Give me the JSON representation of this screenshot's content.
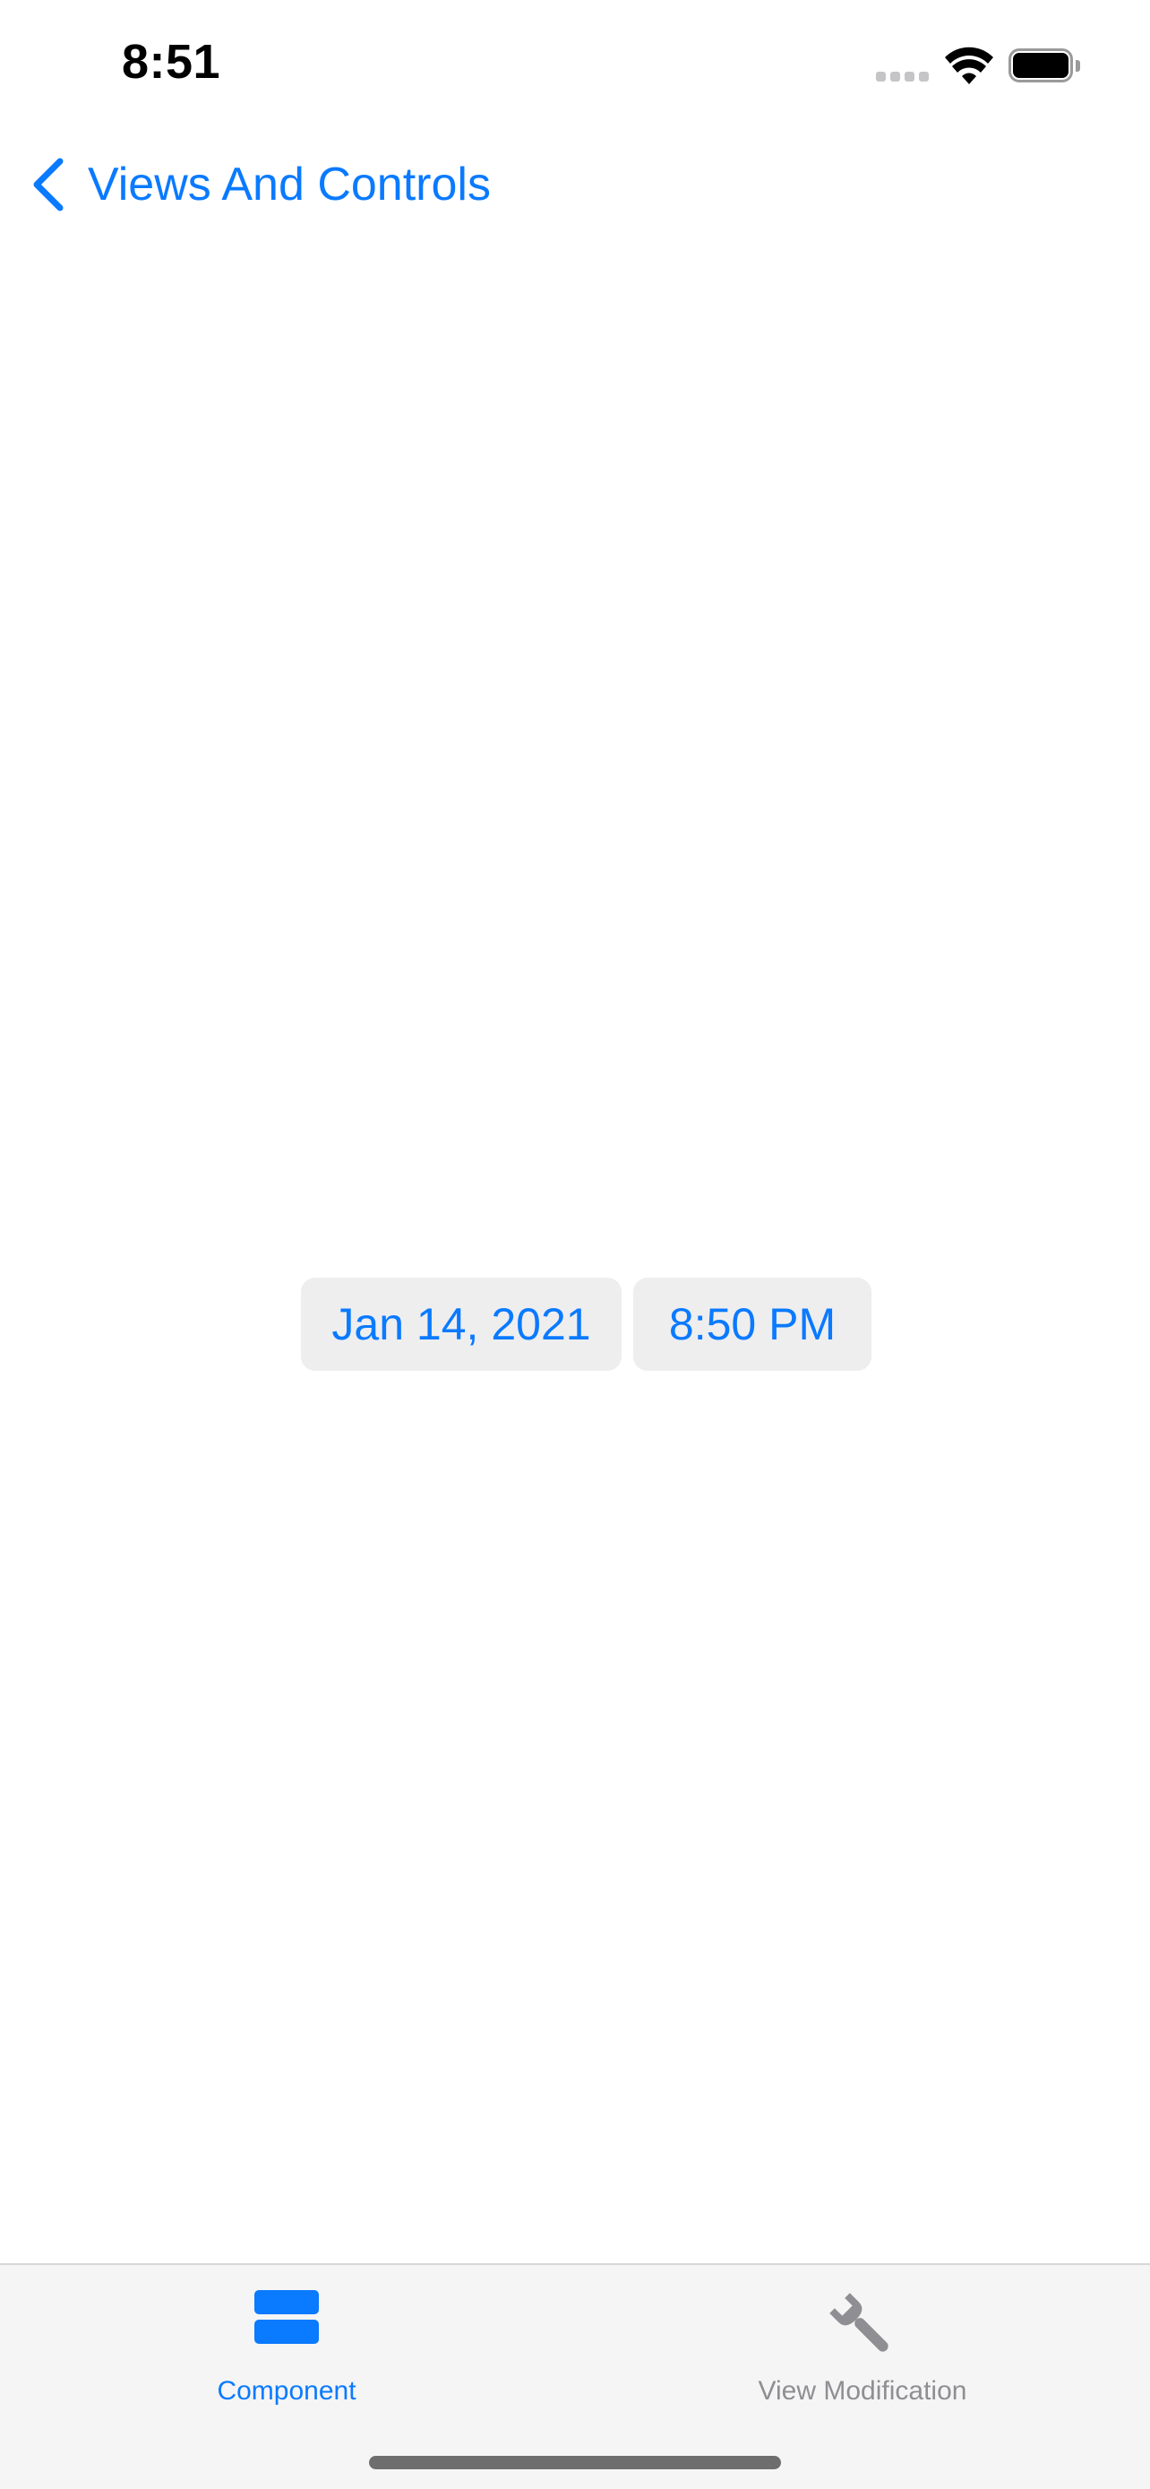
{
  "status_bar": {
    "time": "8:51",
    "signal_icon": "cellular-signal-icon",
    "wifi_icon": "wifi-icon",
    "battery_icon": "battery-icon"
  },
  "nav": {
    "back_icon": "chevron-left-icon",
    "back_label": "Views And Controls"
  },
  "date_picker": {
    "date": "Jan 14, 2021",
    "time": "8:50 PM"
  },
  "tab_bar": {
    "tabs": [
      {
        "label": "Component",
        "icon": "rectangle-stack-icon",
        "selected": true
      },
      {
        "label": "View Modification",
        "icon": "wrench-icon",
        "selected": false
      }
    ]
  },
  "colors": {
    "accent": "#0a7aff",
    "inactive_tab": "#8e8e93",
    "picker_background": "#eeeeef",
    "tab_bar_background": "#f5f5f5"
  }
}
